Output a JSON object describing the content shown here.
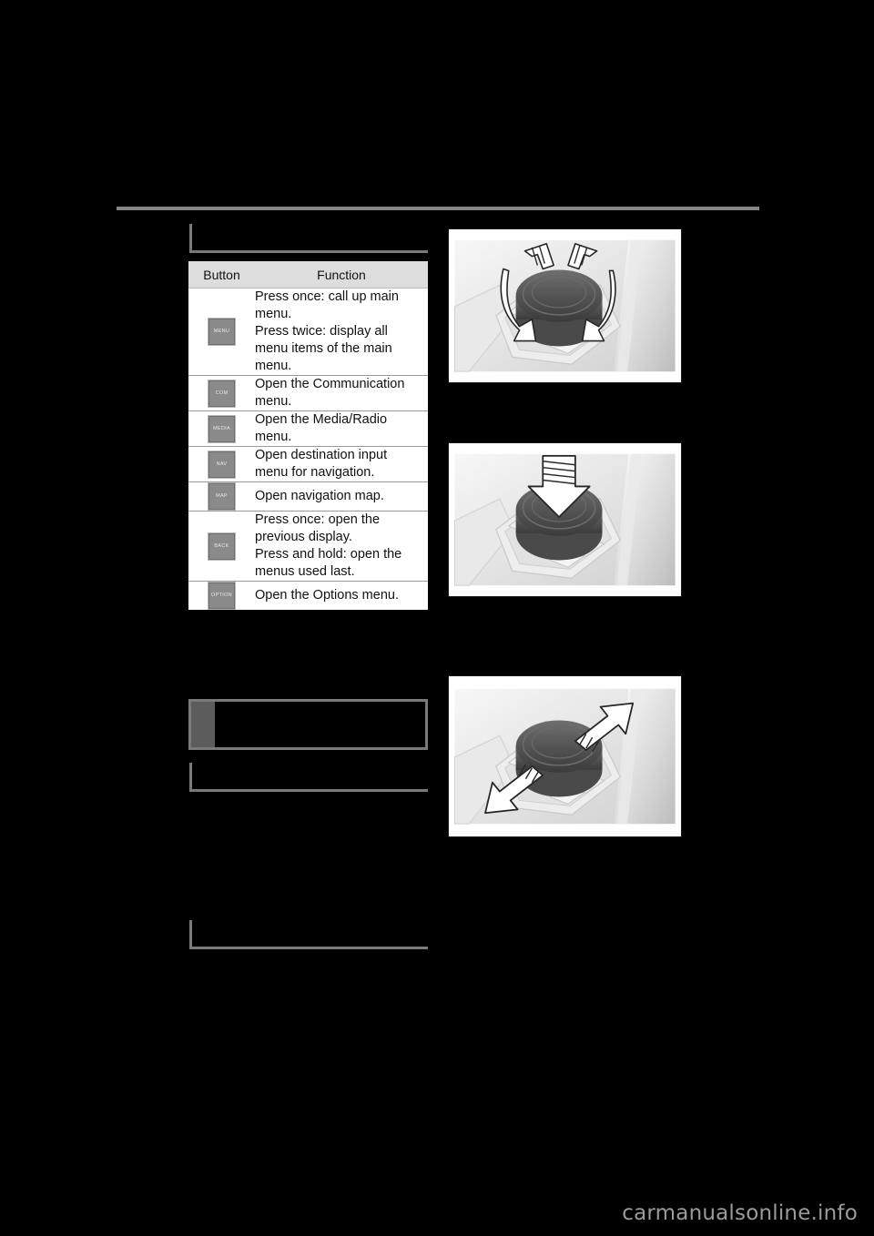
{
  "page": {
    "background_color": "#000000",
    "rule_color": "#878787"
  },
  "headings": {
    "heading_1": "",
    "heading_2": "",
    "heading_3": ""
  },
  "table": {
    "columns": [
      "Button",
      "Function"
    ],
    "rows": [
      {
        "button": "MENU",
        "function_lines": [
          "Press once: call up main",
          "menu.",
          "Press twice: display all",
          "menu items of the main",
          "menu."
        ]
      },
      {
        "button": "COM",
        "function_lines": [
          "Open the Communication",
          "menu."
        ]
      },
      {
        "button": "MEDIA",
        "function_lines": [
          "Open the Media/Radio",
          "menu."
        ]
      },
      {
        "button": "NAV",
        "function_lines": [
          "Open destination input",
          "menu for navigation."
        ]
      },
      {
        "button": "MAP",
        "function_lines": [
          "Open navigation map."
        ]
      },
      {
        "button": "BACK",
        "function_lines": [
          "Press once: open the",
          "previous display.",
          "Press and hold: open the",
          "menus used last."
        ]
      },
      {
        "button": "OPTION",
        "function_lines": [
          "Open the Options menu."
        ]
      }
    ],
    "header_bg": "#dddddd",
    "button_key_color": "#8a8a8a"
  },
  "note_box": {
    "text": "",
    "icon_color": "#5c5c5c",
    "border_color": "#7a7a7a"
  },
  "figures": [
    {
      "name": "controller-rotate",
      "caption": "",
      "action": "rotate"
    },
    {
      "name": "controller-press",
      "caption": "",
      "action": "press"
    },
    {
      "name": "controller-tilt",
      "caption": "",
      "action": "tilt"
    }
  ],
  "watermark": "carmanualsonline.info"
}
